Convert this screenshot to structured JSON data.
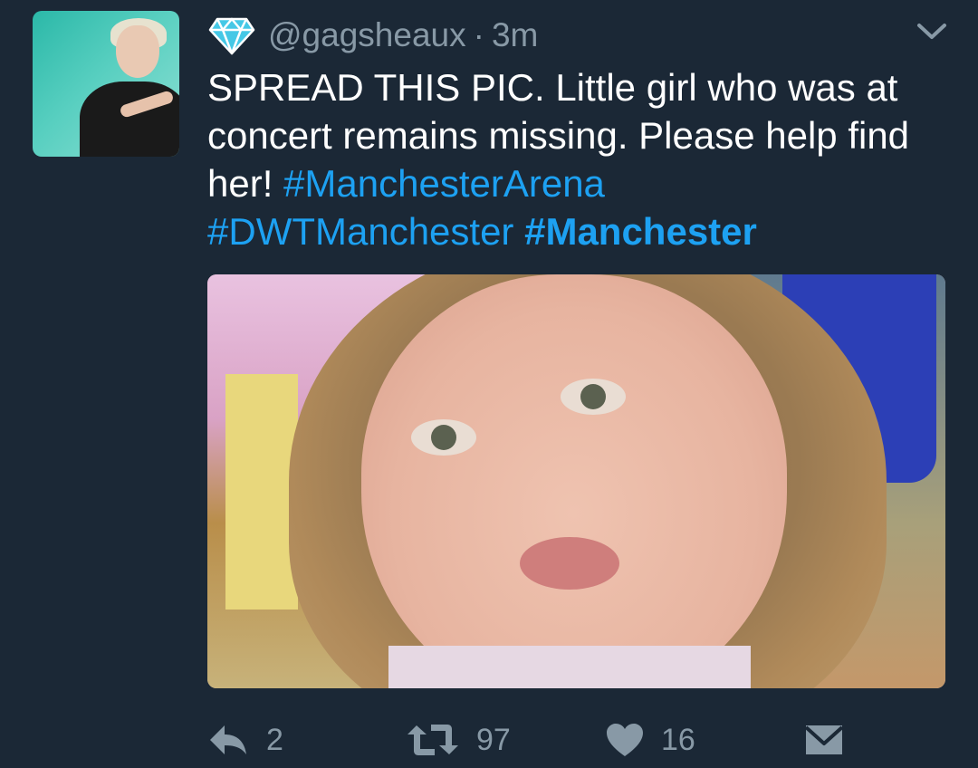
{
  "tweet": {
    "handle": "@gagsheaux",
    "separator": "·",
    "time": "3m",
    "text_plain_1": "SPREAD THIS PIC. Little girl who was at concert remains missing. Please help find her! ",
    "hashtag_1": "#ManchesterArena",
    "hashtag_2": "#DWTManchester",
    "hashtag_3": "#Manchester",
    "reply_count": "2",
    "retweet_count": "97",
    "like_count": "16"
  },
  "colors": {
    "background": "#1b2836",
    "muted": "#8899a6",
    "link": "#1da1f2",
    "diamond": "#45c8e6"
  },
  "icons": {
    "badge": "diamond-icon",
    "menu": "chevron-down-icon",
    "reply": "reply-icon",
    "retweet": "retweet-icon",
    "like": "heart-icon",
    "direct_message": "envelope-icon"
  }
}
